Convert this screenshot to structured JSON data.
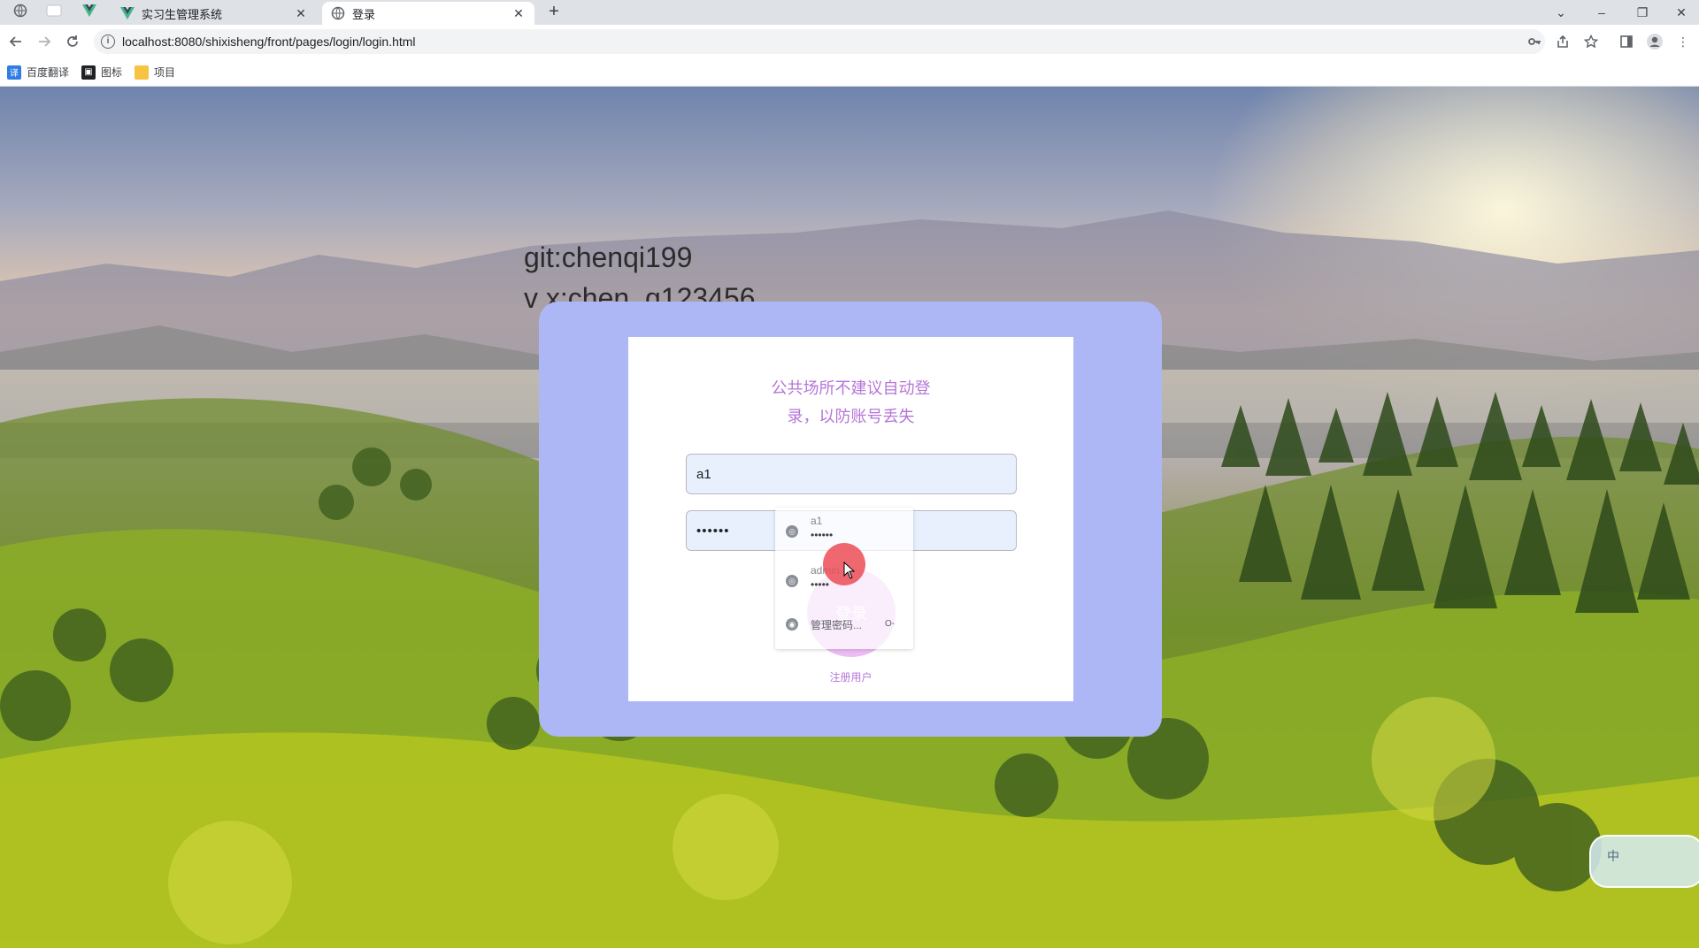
{
  "browser": {
    "tabs": [
      {
        "title": "实习生管理系统",
        "active": false
      },
      {
        "title": "登录",
        "active": true
      }
    ],
    "url": "localhost:8080/shixisheng/front/pages/login/login.html",
    "bookmarks": [
      {
        "label": "百度翻译",
        "icon": "translate-icon",
        "color": "#2f7ce3"
      },
      {
        "label": "图标",
        "icon": "image-icon",
        "color": "#202124"
      },
      {
        "label": "项目",
        "icon": "folder-icon",
        "color": "#f6c342"
      }
    ]
  },
  "page": {
    "overlay_line1": "git:chenqi199",
    "overlay_line2": "v x:chen_q123456",
    "notice_line1": "公共场所不建议自动登",
    "notice_line2": "录，以防账号丢失",
    "username_value": "a1",
    "password_value": "••••••",
    "login_label": "登录",
    "register_label": "注册用户"
  },
  "autofill": {
    "items": [
      {
        "name": "a1",
        "password": "••••••"
      },
      {
        "name": "admin",
        "password": "•••••"
      }
    ],
    "manage_label": "管理密码..."
  },
  "ime": {
    "label": "中"
  },
  "colors": {
    "accent": "#b576d8",
    "card_bg": "#aeb7f5",
    "button_bg": "#e9b6f2",
    "cursor_highlight": "#ec4c56"
  }
}
